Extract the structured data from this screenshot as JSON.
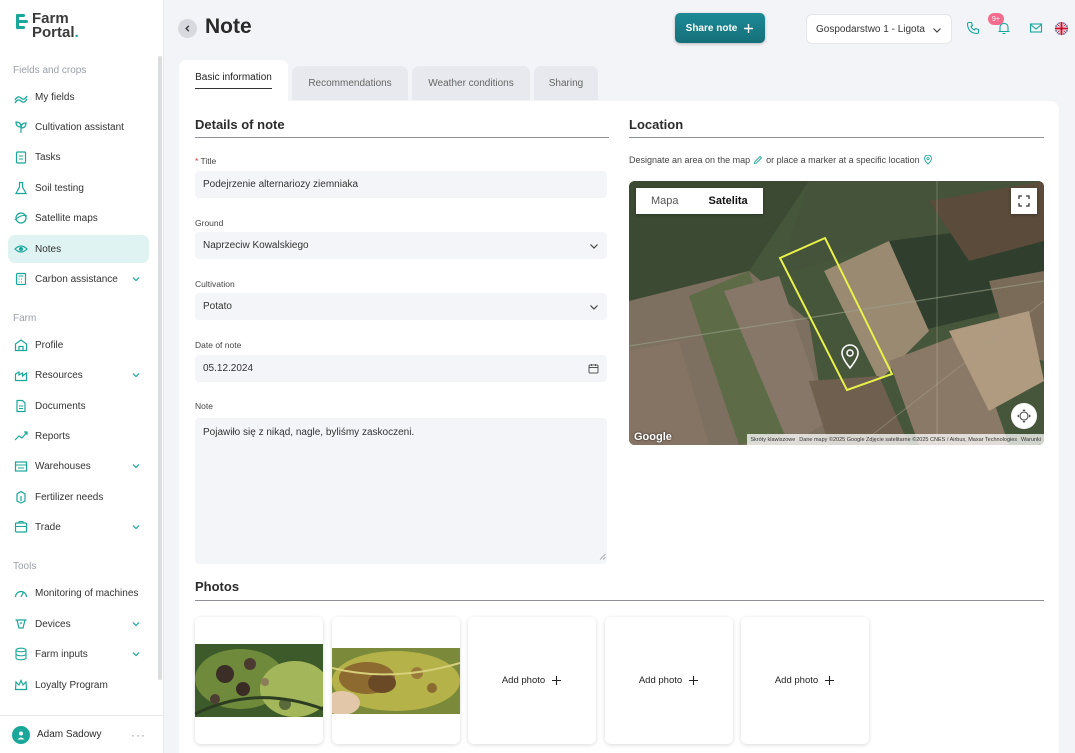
{
  "brand": {
    "line1": "Farm",
    "line2": "Portal",
    "dot": ".",
    "accent": "#19a79a"
  },
  "sidebar": {
    "sections": [
      "Fields and crops",
      "Farm",
      "Tools"
    ],
    "items": [
      {
        "label": "My fields",
        "icon": "fields-icon"
      },
      {
        "label": "Cultivation assistant",
        "icon": "sprout-icon"
      },
      {
        "label": "Tasks",
        "icon": "clipboard-icon"
      },
      {
        "label": "Soil testing",
        "icon": "flask-icon"
      },
      {
        "label": "Satellite maps",
        "icon": "satellite-icon"
      },
      {
        "label": "Notes",
        "icon": "eye-icon",
        "active": true
      },
      {
        "label": "Carbon assistance",
        "icon": "calculator-icon",
        "expandable": true
      },
      {
        "label": "Profile",
        "icon": "barn-icon"
      },
      {
        "label": "Resources",
        "icon": "resources-icon",
        "expandable": true
      },
      {
        "label": "Documents",
        "icon": "document-icon"
      },
      {
        "label": "Reports",
        "icon": "trend-icon"
      },
      {
        "label": "Warehouses",
        "icon": "warehouse-icon",
        "expandable": true
      },
      {
        "label": "Fertilizer needs",
        "icon": "fertilizer-icon"
      },
      {
        "label": "Trade",
        "icon": "trade-icon",
        "expandable": true
      },
      {
        "label": "Monitoring of machines",
        "icon": "gauge-icon"
      },
      {
        "label": "Devices",
        "icon": "device-icon",
        "expandable": true
      },
      {
        "label": "Farm inputs",
        "icon": "database-icon",
        "expandable": true
      },
      {
        "label": "Loyalty Program",
        "icon": "crown-icon"
      }
    ],
    "user": {
      "name": "Adam Sadowy",
      "more": "···"
    }
  },
  "header": {
    "title": "Note",
    "share_label": "Share note",
    "farm": "Gospodarstwo 1 - Ligota",
    "notifications_badge": "9+"
  },
  "tabs": [
    {
      "label": "Basic information",
      "active": true
    },
    {
      "label": "Recommendations"
    },
    {
      "label": "Weather conditions"
    },
    {
      "label": "Sharing"
    }
  ],
  "details": {
    "heading": "Details of note",
    "title_label": "Title",
    "title_required": "*",
    "title_value": "Podejrzenie alternariozy ziemniaka",
    "ground_label": "Ground",
    "ground_value": "Naprzeciw Kowalskiego",
    "cultivation_label": "Cultivation",
    "cultivation_value": "Potato",
    "date_label": "Date of note",
    "date_value": "05.12.2024",
    "note_label": "Note",
    "note_value": "Pojawiło się z nikąd, nagle, byliśmy zaskoczeni."
  },
  "location": {
    "heading": "Location",
    "hint_part1": "Designate an area on the map",
    "hint_part2": "or place a marker at a specific location",
    "map_type_options": [
      "Mapa",
      "Satelita"
    ],
    "map_type_selected": "Satelita",
    "google": "Google",
    "attribution": [
      "Skróty klawiszowe",
      "Dane mapy ©2025 Google Zdjęcie satelitarne ©2025 CNES / Airbus, Maxar Technologies",
      "Warunki"
    ],
    "field_outline_color": "#e8f04a"
  },
  "photos": {
    "heading": "Photos",
    "add_label": "Add photo",
    "count": 2
  }
}
